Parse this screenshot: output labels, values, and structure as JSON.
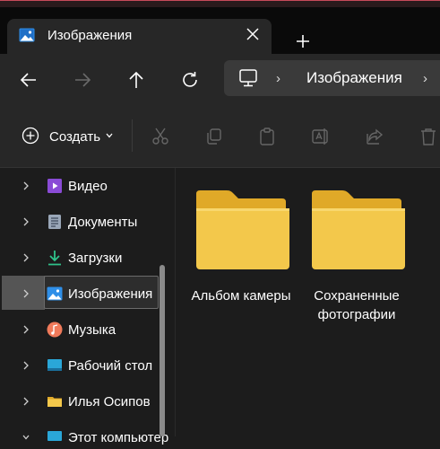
{
  "tab": {
    "title": "Изображения"
  },
  "address": {
    "segment": "Изображения"
  },
  "commands": {
    "create_label": "Создать"
  },
  "sidebar": {
    "items": [
      {
        "label": "Видео",
        "icon": "video-folder-icon"
      },
      {
        "label": "Документы",
        "icon": "documents-folder-icon"
      },
      {
        "label": "Загрузки",
        "icon": "downloads-icon"
      },
      {
        "label": "Изображения",
        "icon": "pictures-folder-icon",
        "selected": true
      },
      {
        "label": "Музыка",
        "icon": "music-folder-icon"
      },
      {
        "label": "Рабочий стол",
        "icon": "desktop-folder-icon"
      },
      {
        "label": "Илья Осипов",
        "icon": "user-folder-icon"
      },
      {
        "label": "Этот компьютер",
        "icon": "this-pc-icon"
      }
    ]
  },
  "content": {
    "folders": [
      {
        "label": "Альбом камеры"
      },
      {
        "label": "Сохраненные фотографии"
      }
    ]
  },
  "colors": {
    "folder": "#f3c84b",
    "folder_dark": "#e0a928",
    "accent": "#3b9cff"
  }
}
